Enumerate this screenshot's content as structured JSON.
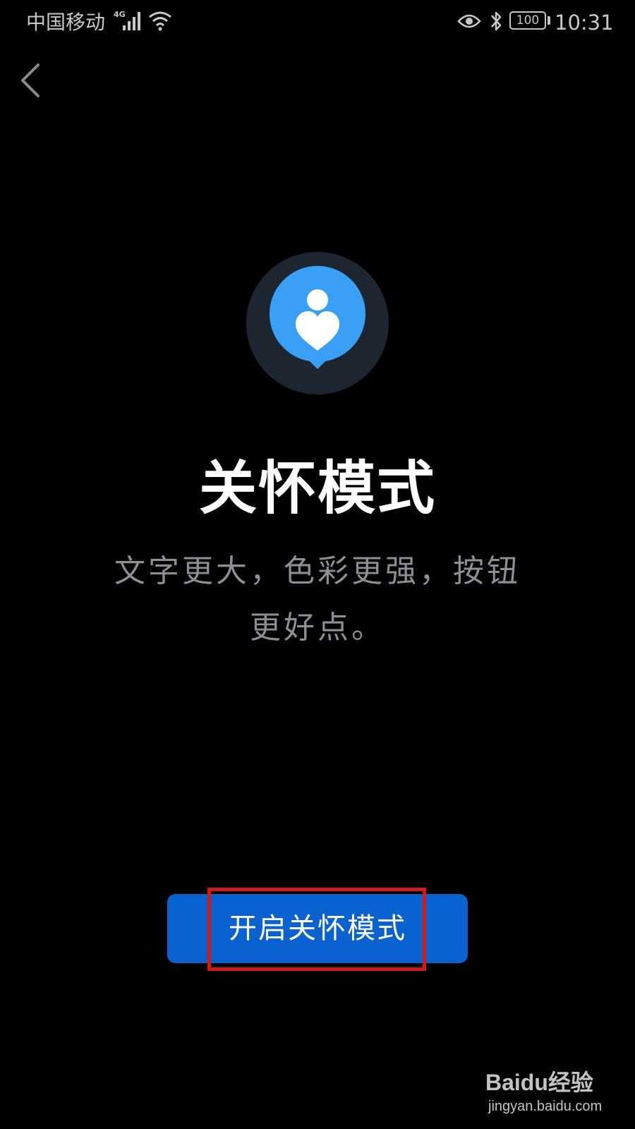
{
  "status_bar": {
    "carrier": "中国移动",
    "network_type": "4G",
    "battery": "100",
    "time": "10:31",
    "icons": [
      "signal-icon",
      "wifi-icon",
      "eye-icon",
      "bluetooth-icon",
      "battery-icon"
    ]
  },
  "nav": {
    "back_icon": "chevron-left-icon"
  },
  "hero": {
    "icon": "care-mode-icon",
    "colors": {
      "outer_ring": "#1c2530",
      "inner_circle": "#3aa0f5",
      "glyph": "#ffffff"
    }
  },
  "content": {
    "title": "关怀模式",
    "description": "文字更大，色彩更强，按钮更好点。"
  },
  "actions": {
    "primary_label": "开启关怀模式",
    "primary_color": "#0a62d0",
    "highlight_color": "#d11a1a"
  },
  "watermark": {
    "brand": "Baidu经验",
    "url": "jingyan.baidu.com"
  }
}
